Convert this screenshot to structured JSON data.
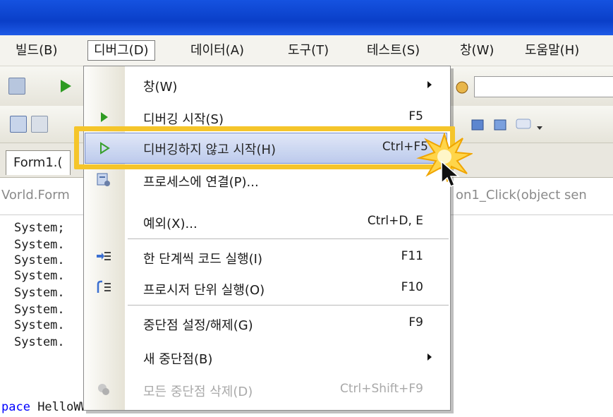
{
  "menubar": {
    "items": [
      {
        "label": "빌드(B)"
      },
      {
        "label": "디버그(D)"
      },
      {
        "label": "데이터(A)"
      },
      {
        "label": "도구(T)"
      },
      {
        "label": "테스트(S)"
      },
      {
        "label": "창(W)"
      },
      {
        "label": "도움말(H)"
      }
    ],
    "active_index": 1
  },
  "tabs": {
    "document_tab": "Form1.("
  },
  "navbar": {
    "left_text": "Vorld.Form",
    "right_text": "on1_Click(object sen"
  },
  "code": {
    "lines": [
      "System;",
      "System.",
      "System.",
      "System.",
      "System.",
      "System.",
      "System.",
      "System."
    ],
    "last_line_keyword": "pace",
    "last_line_text": " HelloWWorld"
  },
  "debug_menu": {
    "items": [
      {
        "label": "창(W)",
        "shortcut": "",
        "submenu": true,
        "enabled": true,
        "icon": ""
      },
      {
        "label": "디버깅 시작(S)",
        "shortcut": "F5",
        "submenu": false,
        "enabled": true,
        "icon": "play-icon"
      },
      {
        "label": "디버깅하지 않고 시작(H)",
        "shortcut": "Ctrl+F5",
        "submenu": false,
        "enabled": true,
        "icon": "play-outline-icon",
        "highlighted": true
      },
      {
        "label": "프로세스에 연결(P)...",
        "shortcut": "",
        "submenu": false,
        "enabled": true,
        "icon": "attach-process-icon"
      },
      {
        "label": "예외(X)...",
        "shortcut": "Ctrl+D, E",
        "submenu": false,
        "enabled": true,
        "icon": ""
      },
      {
        "label": "한 단계씩 코드 실행(I)",
        "shortcut": "F11",
        "submenu": false,
        "enabled": true,
        "icon": "step-into-icon"
      },
      {
        "label": "프로시저 단위 실행(O)",
        "shortcut": "F10",
        "submenu": false,
        "enabled": true,
        "icon": "step-over-icon"
      },
      {
        "label": "중단점 설정/해제(G)",
        "shortcut": "F9",
        "submenu": false,
        "enabled": true,
        "icon": ""
      },
      {
        "label": "새 중단점(B)",
        "shortcut": "",
        "submenu": true,
        "enabled": true,
        "icon": ""
      },
      {
        "label": "모든 중단점 삭제(D)",
        "shortcut": "Ctrl+Shift+F9",
        "submenu": false,
        "enabled": false,
        "icon": "delete-breakpoints-icon"
      }
    ]
  },
  "colors": {
    "title_bar": "#0a3fc8",
    "highlight_frame": "#f5c52a",
    "selection": "#b9c8ec",
    "disabled_text": "#a9a9a9",
    "keyword": "#0000ff"
  }
}
